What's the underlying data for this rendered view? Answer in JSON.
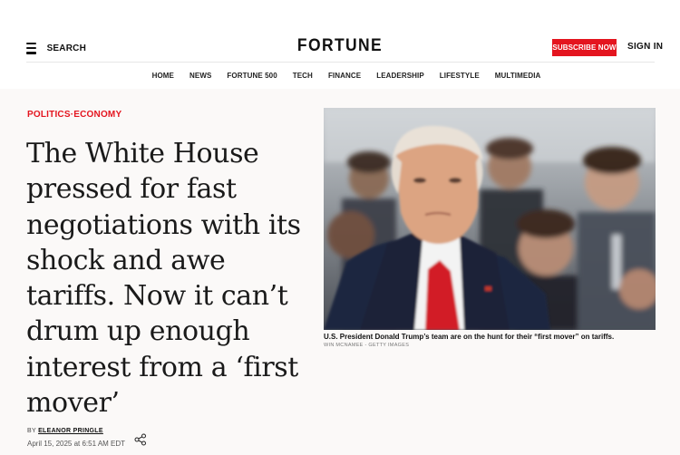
{
  "header": {
    "search_label": "SEARCH",
    "logo": "FORTUNE",
    "subscribe_label": "SUBSCRIBE NOW",
    "signin_label": "SIGN IN",
    "nav": [
      "HOME",
      "NEWS",
      "FORTUNE 500",
      "TECH",
      "FINANCE",
      "LEADERSHIP",
      "LIFESTYLE",
      "MULTIMEDIA"
    ]
  },
  "article": {
    "category_1": "POLITICS",
    "category_sep": "·",
    "category_2": "ECONOMY",
    "headline": "The White House pressed for fast negotiations with its shock and awe tariffs. Now it can’t drum up enough interest from a ‘first mover’",
    "by_prefix": "BY",
    "author": "ELEANOR PRINGLE",
    "date": "April 15, 2025 at 6:51 AM EDT",
    "caption": "U.S. President Donald Trump’s team are on the hunt for their “first mover” on tariffs.",
    "credit": "WIN MCNAMEE - GETTY IMAGES"
  },
  "colors": {
    "brand_red": "#e4151f",
    "background": "#fbf9f8"
  },
  "icons": [
    "hamburger-menu-icon",
    "share-icon"
  ]
}
